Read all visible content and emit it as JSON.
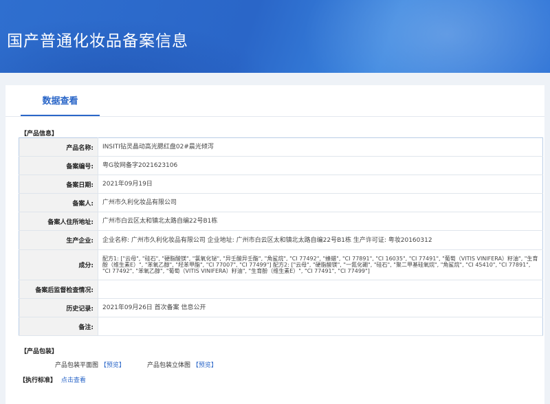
{
  "header": {
    "title": "国产普通化妆品备案信息"
  },
  "tabs": [
    {
      "label": "数据查看",
      "active": true
    }
  ],
  "product_section": {
    "title": "【产品信息】"
  },
  "rows": [
    {
      "label": "产品名称:",
      "value": "INSITI钻灵晶动高光腮红盘02#晨光倾泻"
    },
    {
      "label": "备案编号:",
      "value": "粤G妆网备字2021623106"
    },
    {
      "label": "备案日期:",
      "value": "2021年09月19日"
    },
    {
      "label": "备案人:",
      "value": "广州市久利化妆品有限公司"
    },
    {
      "label": "备案人住所地址:",
      "value": "广州市白云区太和镇北太路自编22号B1栋"
    },
    {
      "label": "生产企业:",
      "value": "企业名称: 广州市久利化妆品有限公司 企业地址: 广州市白云区太和镇北太路自编22号B1栋 生产许可证: 粤妆20160312"
    },
    {
      "label": "成分:",
      "value": "配方1: [\"云母\", \"硅石\", \"硬脂酸镁\", \"氯氧化铋\", \"异壬酸异壬酯\", \"角鲨烷\", \"CI 77492\", \"蜂蜡\", \"CI 77891\", \"CI 16035\", \"CI 77491\", \"葡萄（VITIS VINIFERA）籽油\", \"生育酚（维生素E）\", \"苯氧乙醇\", \"羟苯甲酯\", \"CI 77007\", \"CI 77499\"] 配方2: [\"云母\", \"硬脂酸镁\", \"一氮化硼\", \"硅石\", \"聚二甲基硅氧烷\", \"角鲨烷\", \"CI 45410\", \"CI 77891\", \"CI 77492\", \"苯氧乙醇\", \"葡萄（VITIS VINIFERA）籽油\", \"生育酚（维生素E）\", \"CI 77491\", \"CI 77499\"]"
    },
    {
      "label": "备案后监督检查情况:",
      "value": ""
    },
    {
      "label": "历史记录:",
      "value": "2021年09月26日 首次备案 信息公开"
    },
    {
      "label": "备注:",
      "value": ""
    }
  ],
  "package_section": {
    "title": "【产品包装】",
    "flat_label": "产品包装平面图",
    "flat_link": "【预览】",
    "solid_label": "产品包装立体图",
    "solid_link": "【预览】"
  },
  "standard_section": {
    "title": "【执行标准】",
    "link": "点击查看"
  },
  "colors": {
    "accent": "#2a66c8",
    "banner": "#2f6fcf"
  }
}
